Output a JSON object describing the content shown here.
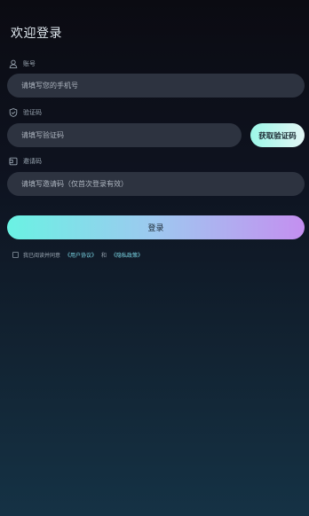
{
  "title": "欢迎登录",
  "account": {
    "label": "账号",
    "placeholder": "请填写您的手机号"
  },
  "code": {
    "label": "验证码",
    "placeholder": "请填写验证码",
    "button": "获取验证码"
  },
  "invite": {
    "label": "邀请码",
    "placeholder": "请填写邀请码（仅首次登录有效）"
  },
  "login_button": "登录",
  "agreement": {
    "prefix": "我已阅读并同意",
    "user_agreement": "《用户协议》",
    "and": "和",
    "privacy_policy": "《隐私政策》"
  },
  "colors": {
    "accent_teal": "#6af2e3",
    "accent_purple": "#c48ff0",
    "input_bg": "#2d3340"
  }
}
